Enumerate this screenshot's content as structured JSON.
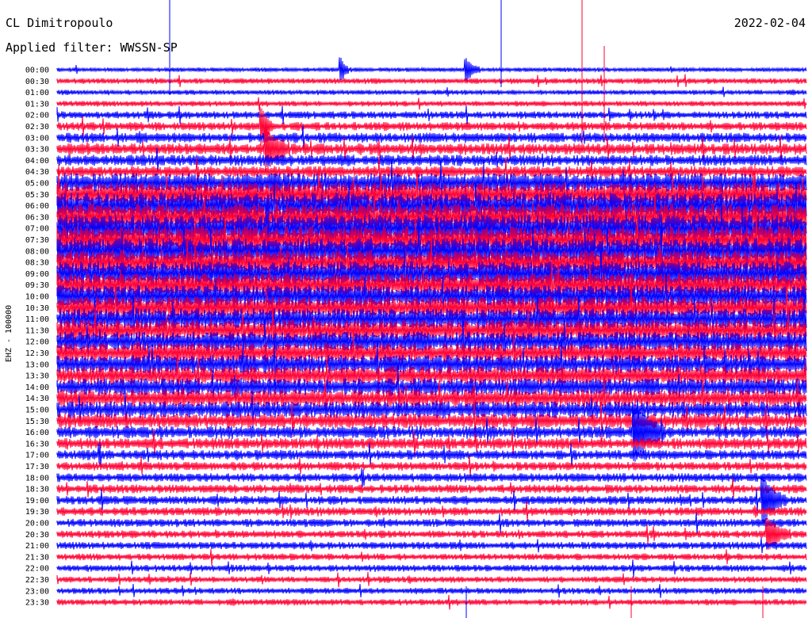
{
  "header": {
    "station": "CL Dimitropoulo",
    "filter": "Applied filter: WWSSN-SP",
    "date": "2022-02-04"
  },
  "chart_data": {
    "type": "line",
    "ylabel": "EHZ - 100000",
    "row_labels": [
      "00:00",
      "00:30",
      "01:00",
      "01:30",
      "02:00",
      "02:30",
      "03:00",
      "03:30",
      "04:00",
      "04:30",
      "05:00",
      "05:30",
      "06:00",
      "06:30",
      "07:00",
      "07:30",
      "08:00",
      "08:30",
      "09:00",
      "09:30",
      "10:00",
      "10:30",
      "11:00",
      "11:30",
      "12:00",
      "12:30",
      "13:00",
      "13:30",
      "14:00",
      "14:30",
      "15:00",
      "15:30",
      "16:00",
      "16:30",
      "17:00",
      "17:30",
      "18:00",
      "18:30",
      "19:00",
      "19:30",
      "20:00",
      "20:30",
      "21:00",
      "21:30",
      "22:00",
      "22:30",
      "23:00",
      "23:30"
    ],
    "series_colors": [
      "#0000ff",
      "#ff0033"
    ],
    "row_activity": [
      0.35,
      0.45,
      0.4,
      0.45,
      0.6,
      0.7,
      0.8,
      0.9,
      0.9,
      0.9,
      1.6,
      1.9,
      2.1,
      2.2,
      2.2,
      2.2,
      2.1,
      2.0,
      2.0,
      1.9,
      1.8,
      1.8,
      1.7,
      1.7,
      1.6,
      1.6,
      1.5,
      1.5,
      1.4,
      1.4,
      1.3,
      1.2,
      1.0,
      0.9,
      0.8,
      0.7,
      0.7,
      0.7,
      0.7,
      0.7,
      0.65,
      0.6,
      0.6,
      0.55,
      0.55,
      0.5,
      0.5,
      0.5
    ]
  }
}
